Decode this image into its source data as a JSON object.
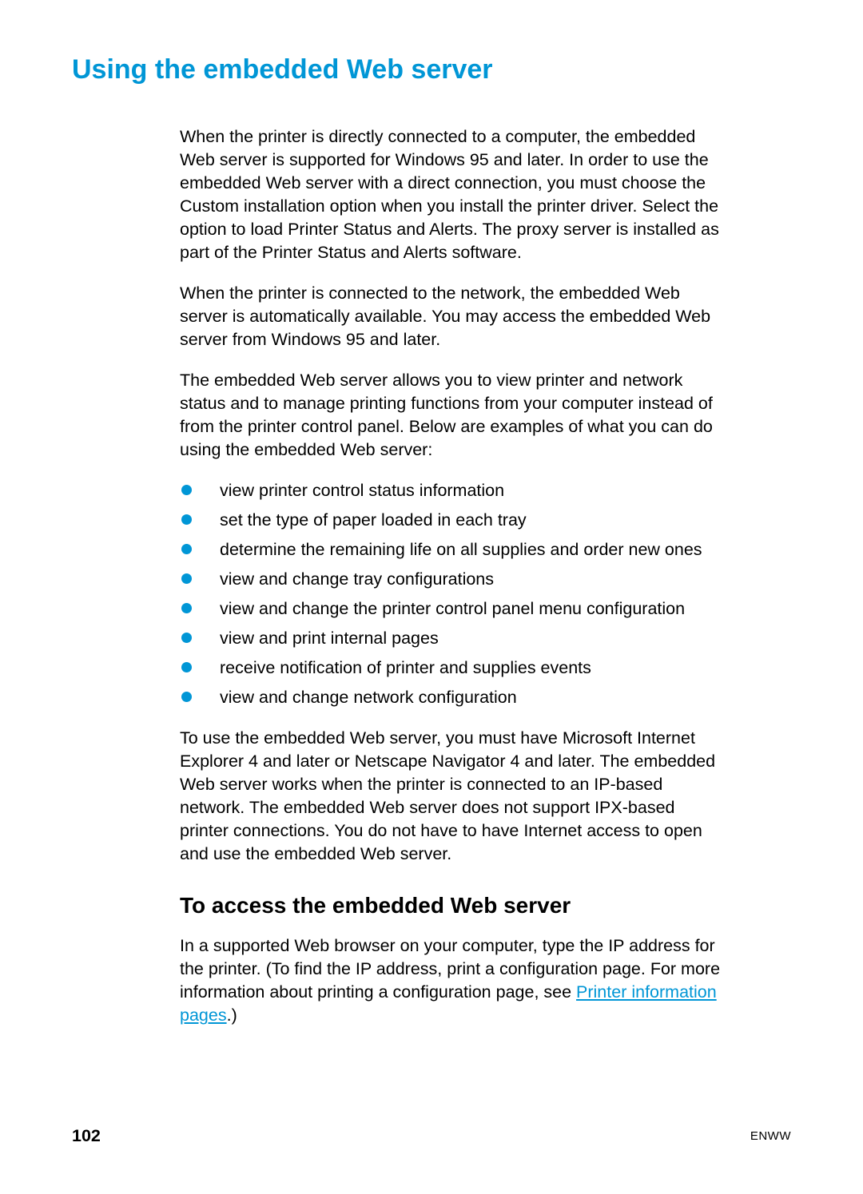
{
  "title": "Using the embedded Web server",
  "paras": {
    "p1": "When the printer is directly connected to a computer, the embedded Web server is supported for Windows 95 and later. In order to use the embedded Web server with a direct connection, you must choose the Custom installation option when you install the printer driver. Select the option to load Printer Status and Alerts. The proxy server is installed as part of the Printer Status and Alerts software.",
    "p2": "When the printer is connected to the network, the embedded Web server is automatically available. You may access the embedded Web server from Windows 95 and later.",
    "p3": "The embedded Web server allows you to view printer and network status and to manage printing functions from your computer instead of from the printer control panel. Below are examples of what you can do using the embedded Web server:",
    "p4": "To use the embedded Web server, you must have Microsoft Internet Explorer 4 and later or Netscape Navigator 4 and later. The embedded Web server works when the printer is connected to an IP-based network. The embedded Web server does not support IPX-based printer connections. You do not have to have Internet access to open and use the embedded Web server."
  },
  "bullets": [
    "view printer control status information",
    "set the type of paper loaded in each tray",
    "determine the remaining life on all supplies and order new ones",
    "view and change tray configurations",
    "view and change the printer control panel menu configuration",
    "view and print internal pages",
    "receive notification of printer and supplies events",
    "view and change network configuration"
  ],
  "h2": "To access the embedded Web server",
  "p5_before": "In a supported Web browser on your computer, type the IP address for the printer. (To find the IP address, print a configuration page. For more information about printing a configuration page, see ",
  "p5_link": "Printer information pages",
  "p5_after": ".)",
  "footer": {
    "page": "102",
    "right": "ENWW"
  }
}
